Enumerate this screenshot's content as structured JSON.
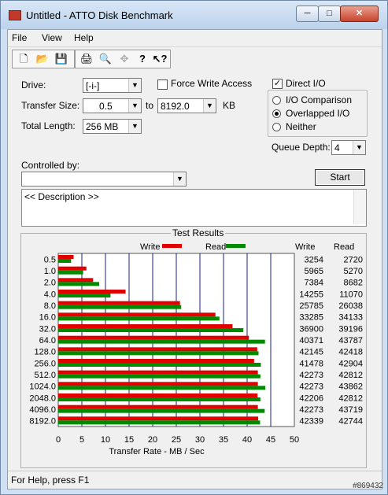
{
  "window": {
    "title": "Untitled - ATTO Disk Benchmark"
  },
  "menu": {
    "file": "File",
    "view": "View",
    "help": "Help"
  },
  "settings": {
    "drive_label": "Drive:",
    "drive_value": "[-i-]",
    "force_write_label": "Force Write Access",
    "direct_io_label": "Direct I/O",
    "transfer_size_label": "Transfer Size:",
    "transfer_from": "0.5",
    "to_label": "to",
    "transfer_to": "8192.0",
    "kb_label": "KB",
    "total_length_label": "Total Length:",
    "total_length_value": "256 MB",
    "io_comparison_label": "I/O Comparison",
    "overlapped_io_label": "Overlapped I/O",
    "neither_label": "Neither",
    "queue_depth_label": "Queue Depth:",
    "queue_depth_value": "4",
    "controlled_by_label": "Controlled by:",
    "controlled_by_value": "",
    "start_label": "Start",
    "description_text": "<< Description >>"
  },
  "results": {
    "title": "Test Results",
    "write_legend": "Write",
    "read_legend": "Read",
    "write_col": "Write",
    "read_col": "Read"
  },
  "status": {
    "text": "For Help, press F1"
  },
  "watermark": "#869432",
  "colors": {
    "write": "#e00000",
    "read": "#008a00",
    "grid": "#1c1c8c"
  },
  "chart_data": {
    "type": "bar",
    "orientation": "horizontal",
    "title": "Test Results",
    "xlabel": "Transfer Rate - MB / Sec",
    "xlim": [
      0,
      50
    ],
    "xticks": [
      0,
      5,
      10,
      15,
      20,
      25,
      30,
      35,
      40,
      45,
      50
    ],
    "categories": [
      "0.5",
      "1.0",
      "2.0",
      "4.0",
      "8.0",
      "16.0",
      "32.0",
      "64.0",
      "128.0",
      "256.0",
      "512.0",
      "1024.0",
      "2048.0",
      "4096.0",
      "8192.0"
    ],
    "series": [
      {
        "name": "Write",
        "values": [
          3254,
          5965,
          7384,
          14255,
          25785,
          33285,
          36900,
          40371,
          42145,
          41478,
          42273,
          42273,
          42206,
          42273,
          42339
        ]
      },
      {
        "name": "Read",
        "values": [
          2720,
          5270,
          8682,
          11070,
          26038,
          34133,
          39196,
          43787,
          42418,
          42904,
          42812,
          43862,
          42812,
          43719,
          42744
        ]
      }
    ]
  }
}
